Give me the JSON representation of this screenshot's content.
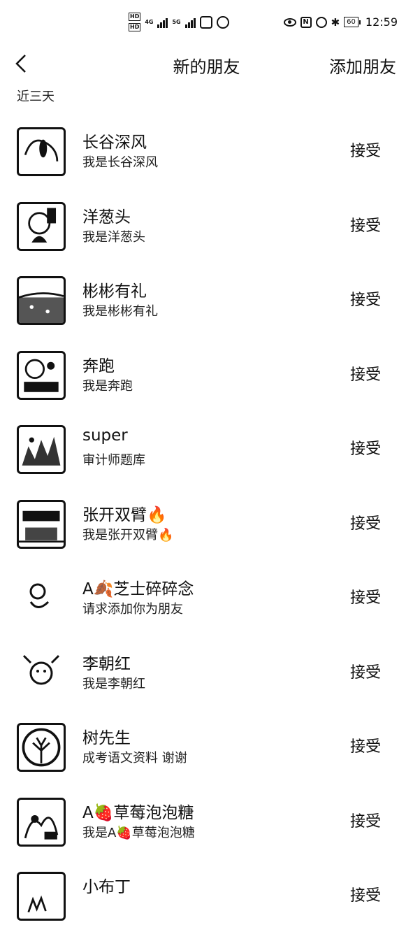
{
  "status_bar": {
    "hd_top": "HD",
    "hd_bottom": "HD",
    "network": "4G",
    "network2": "5G",
    "nfc": "N",
    "battery": "60",
    "time": "12:59"
  },
  "nav": {
    "title": "新的朋友",
    "action_label": "添加朋友"
  },
  "section_label": "近三天",
  "accept_label": "接受",
  "requests": [
    {
      "name": "长谷深风",
      "message": "我是长谷深风",
      "avatar": "portrait-photo"
    },
    {
      "name": "洋葱头",
      "message": "我是洋葱头",
      "avatar": "face-photo"
    },
    {
      "name": "彬彬有礼",
      "message": "我是彬彬有礼",
      "avatar": "landscape-photo"
    },
    {
      "name": "奔跑",
      "message": "我是奔跑",
      "avatar": "cartoon-photo"
    },
    {
      "name": "super",
      "message": "审计师题库",
      "avatar": "collage-photo"
    },
    {
      "name": "张开双臂🔥",
      "message": "我是张开双臂🔥",
      "avatar": "street-sign-photo"
    },
    {
      "name": "A🍂芝士碎碎念",
      "message": "请求添加你为朋友",
      "avatar": "sketch-photo"
    },
    {
      "name": "李朝红",
      "message": "我是李朝红",
      "avatar": "girl-sketch"
    },
    {
      "name": "树先生",
      "message": "成考语文资料 谢谢",
      "avatar": "tree-logo"
    },
    {
      "name": "A🍓草莓泡泡糖",
      "message": "我是A🍓草莓泡泡糖",
      "avatar": "flower-photo"
    },
    {
      "name": "小布丁",
      "message": "",
      "avatar": "hand-drawn"
    }
  ]
}
